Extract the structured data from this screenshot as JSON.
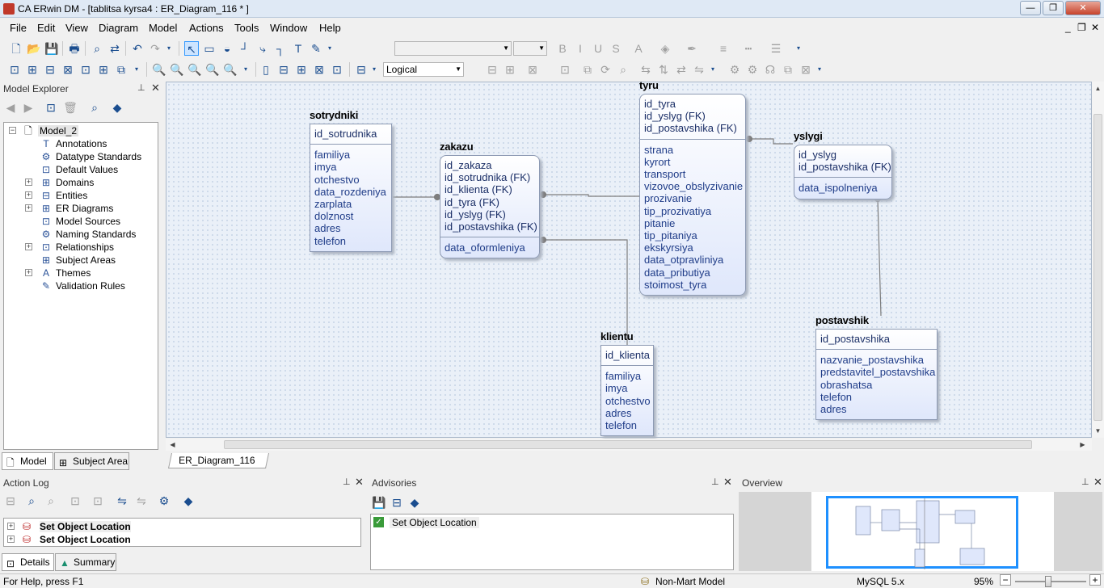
{
  "window": {
    "title": "CA ERwin DM - [tablitsa kyrsa4 : ER_Diagram_116 * ]",
    "controls": {
      "minimize": "—",
      "restore": "❐",
      "close": "✕"
    },
    "mdi_controls": {
      "minimize": "_",
      "restore": "❐",
      "close": "✕"
    }
  },
  "menu": [
    "File",
    "Edit",
    "View",
    "Diagram",
    "Model",
    "Actions",
    "Tools",
    "Window",
    "Help"
  ],
  "toolbar": {
    "display_level": "Logical",
    "font_combo": "",
    "size_combo": ""
  },
  "model_explorer": {
    "title": "Model Explorer",
    "root": "Model_2",
    "items": [
      {
        "label": "Annotations",
        "icon": "annotations-icon",
        "expandable": false
      },
      {
        "label": "Datatype Standards",
        "icon": "datatype-standards-icon",
        "expandable": false
      },
      {
        "label": "Default Values",
        "icon": "default-values-icon",
        "expandable": false
      },
      {
        "label": "Domains",
        "icon": "domains-icon",
        "expandable": true
      },
      {
        "label": "Entities",
        "icon": "entities-icon",
        "expandable": true
      },
      {
        "label": "ER Diagrams",
        "icon": "er-diagrams-icon",
        "expandable": true
      },
      {
        "label": "Model Sources",
        "icon": "model-sources-icon",
        "expandable": false
      },
      {
        "label": "Naming Standards",
        "icon": "naming-standards-icon",
        "expandable": false
      },
      {
        "label": "Relationships",
        "icon": "relationships-icon",
        "expandable": true
      },
      {
        "label": "Subject Areas",
        "icon": "subject-areas-icon",
        "expandable": false
      },
      {
        "label": "Themes",
        "icon": "themes-icon",
        "expandable": true
      },
      {
        "label": "Validation Rules",
        "icon": "validation-rules-icon",
        "expandable": false
      }
    ],
    "tabs": [
      "Model",
      "Subject Area"
    ]
  },
  "diagram": {
    "tab": "ER_Diagram_116",
    "entities": {
      "sotrydniki": {
        "name": "sotrydniki",
        "keys": [
          "id_sotrudnika"
        ],
        "attrs": [
          "familiya",
          "imya",
          "otchestvo",
          "data_rozdeniya",
          "zarplata",
          "dolznost",
          "adres",
          "telefon"
        ]
      },
      "zakazu": {
        "name": "zakazu",
        "keys": [
          "id_zakaza",
          "id_sotrudnika (FK)",
          "id_klienta (FK)",
          "id_tyra (FK)",
          "id_yslyg (FK)",
          "id_postavshika (FK)"
        ],
        "attrs": [
          "data_oformleniya"
        ]
      },
      "tyru": {
        "name": "tyru",
        "keys": [
          "id_tyra",
          "id_yslyg (FK)",
          "id_postavshika (FK)"
        ],
        "attrs": [
          "strana",
          "kyrort",
          "transport",
          "vizovoe_obslyzivanie",
          "prozivanie",
          "tip_prozivatiya",
          "pitanie",
          "tip_pitaniya",
          "ekskyrsiya",
          "data_otpravliniya",
          "data_pributiya",
          "stoimost_tyra"
        ]
      },
      "yslygi": {
        "name": "yslygi",
        "keys": [
          "id_yslyg",
          "id_postavshika (FK)"
        ],
        "attrs": [
          "data_ispolneniya"
        ]
      },
      "klientu": {
        "name": "klientu",
        "keys": [
          "id_klienta"
        ],
        "attrs": [
          "familiya",
          "imya",
          "otchestvo",
          "adres",
          "telefon"
        ]
      },
      "postavshik": {
        "name": "postavshik",
        "keys": [
          "id_postavshika"
        ],
        "attrs": [
          "nazvanie_postavshika",
          "predstavitel_postavshika",
          "obrashatsa",
          "telefon",
          "adres"
        ]
      }
    }
  },
  "action_log": {
    "title": "Action Log",
    "entries": [
      "Set Object Location",
      "Set Object Location"
    ],
    "tabs": [
      "Details",
      "Summary"
    ]
  },
  "advisories": {
    "title": "Advisories",
    "entries": [
      "Set Object Location"
    ]
  },
  "overview": {
    "title": "Overview"
  },
  "status": {
    "help": "For Help, press F1",
    "model_type": "Non-Mart Model",
    "database": "MySQL 5.x",
    "zoom": "95%"
  },
  "colors": {
    "canvas": "#eaf0f8",
    "entity_text": "#1f3c88",
    "accent": "#1e90ff"
  }
}
